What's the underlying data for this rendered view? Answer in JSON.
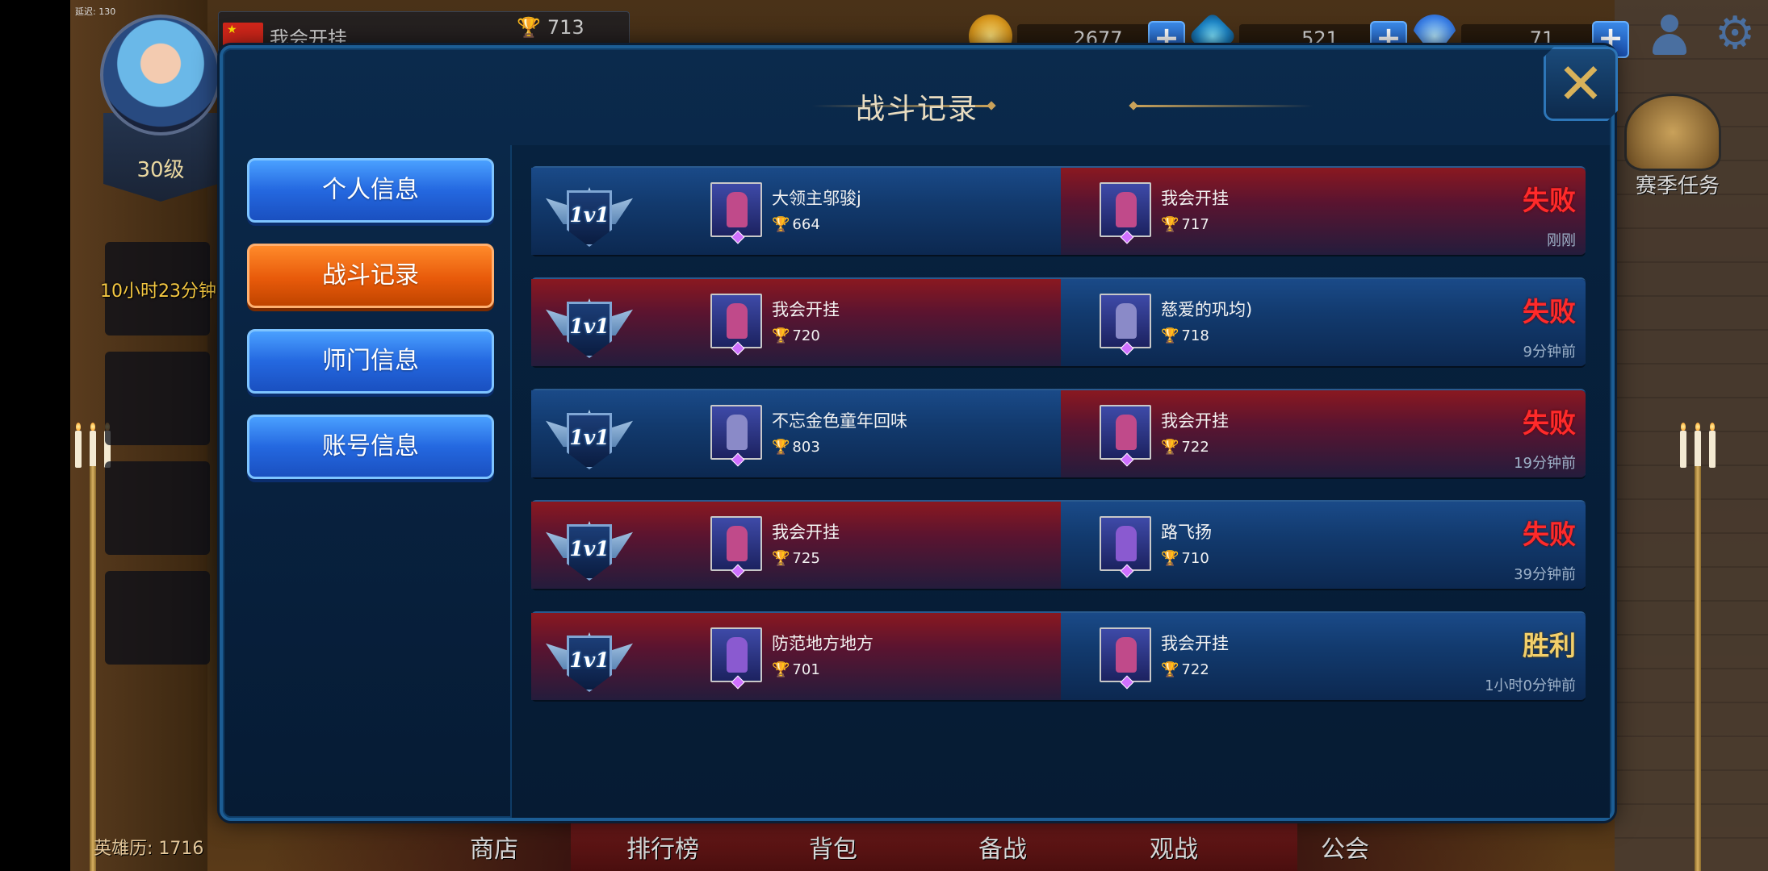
{
  "hud": {
    "latency": "延迟: 130",
    "player_name": "我会开挂",
    "trophies": "713",
    "gold": "2677",
    "gems": "521",
    "diamonds": "71",
    "level": "30级",
    "timer": "10小时23分钟",
    "history": "英雄历: 1716",
    "season_task": "赛季任务"
  },
  "bottom_nav": [
    "商店",
    "排行榜",
    "背包",
    "备战",
    "观战",
    "公会"
  ],
  "dialog": {
    "title": "战斗记录",
    "close_label": "✕",
    "tabs": [
      {
        "label": "个人信息",
        "active": false
      },
      {
        "label": "战斗记录",
        "active": true
      },
      {
        "label": "师门信息",
        "active": false
      },
      {
        "label": "账号信息",
        "active": false
      }
    ]
  },
  "records": [
    {
      "mode": "1v1",
      "left": {
        "name": "大领主邬骏j",
        "trophies": "664",
        "side": "blue"
      },
      "right": {
        "name": "我会开挂",
        "trophies": "717",
        "side": "red"
      },
      "result": "失败",
      "outcome": "lose",
      "time": "刚刚"
    },
    {
      "mode": "1v1",
      "left": {
        "name": "我会开挂",
        "trophies": "720",
        "side": "red"
      },
      "right": {
        "name": "慈爱的巩均)",
        "trophies": "718",
        "side": "blue"
      },
      "result": "失败",
      "outcome": "lose",
      "time": "9分钟前"
    },
    {
      "mode": "1v1",
      "left": {
        "name": "不忘金色童年回味",
        "trophies": "803",
        "side": "blue"
      },
      "right": {
        "name": "我会开挂",
        "trophies": "722",
        "side": "red"
      },
      "result": "失败",
      "outcome": "lose",
      "time": "19分钟前"
    },
    {
      "mode": "1v1",
      "left": {
        "name": "我会开挂",
        "trophies": "725",
        "side": "red"
      },
      "right": {
        "name": "路飞扬",
        "trophies": "710",
        "side": "blue"
      },
      "result": "失败",
      "outcome": "lose",
      "time": "39分钟前"
    },
    {
      "mode": "1v1",
      "left": {
        "name": "防范地方地方",
        "trophies": "701",
        "side": "red"
      },
      "right": {
        "name": "我会开挂",
        "trophies": "722",
        "side": "blue"
      },
      "result": "胜利",
      "outcome": "win",
      "time": "1小时0分钟前"
    }
  ],
  "colors": {
    "lose": "#ff2a2a",
    "win": "#f2cf6a",
    "tab_active": "#e85a0a",
    "tab_default": "#2468e0"
  },
  "icons": {
    "trophy": "trophy-icon",
    "close": "close-icon",
    "settings": "gear-icon",
    "profile": "profile-icon"
  }
}
